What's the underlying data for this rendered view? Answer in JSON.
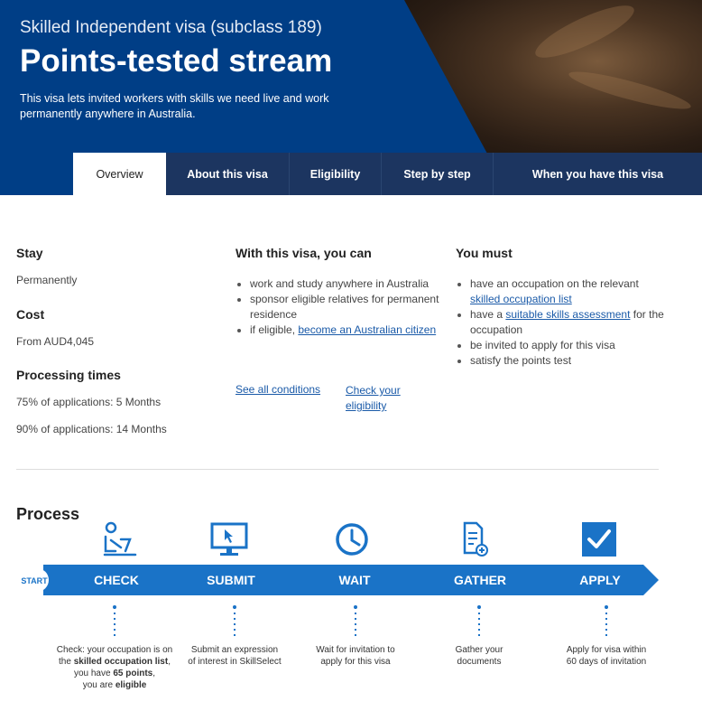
{
  "hero": {
    "subtitle": "Skilled Independent visa (subclass 189)",
    "title": "Points-tested stream",
    "description": "This visa lets invited workers with skills we need live and work permanently anywhere in Australia."
  },
  "tabs": [
    {
      "label": "Overview",
      "active": true
    },
    {
      "label": "About this visa",
      "active": false
    },
    {
      "label": "Eligibility",
      "active": false
    },
    {
      "label": "Step by step",
      "active": false
    },
    {
      "label": "When you have this visa",
      "active": false
    }
  ],
  "summary": {
    "stay_label": "Stay",
    "stay_value": "Permanently",
    "cost_label": "Cost",
    "cost_value": "From AUD4,045",
    "processing_label": "Processing times",
    "processing_75": "75% of applications: 5 Months",
    "processing_90": "90% of applications: 14 Months"
  },
  "can": {
    "heading": "With this visa, you can",
    "items": [
      "work and study anywhere in Australia",
      "sponsor eligible relatives for permanent residence"
    ],
    "item3_prefix": "if eligible, ",
    "item3_link": "become an Australian citizen"
  },
  "must": {
    "heading": "You must",
    "item1_prefix": "have an occupation on the relevant ",
    "item1_link": "skilled occupation list",
    "item2_prefix": "have a ",
    "item2_link": "suitable skills assessment",
    "item2_suffix": " for the occupation",
    "item3": "be invited to apply for this visa",
    "item4": "satisfy the points test"
  },
  "links": {
    "see_all": "See all conditions",
    "check_eligibility": "Check your eligibility"
  },
  "process": {
    "title": "Process",
    "start": "START",
    "accent": "#1a73c7",
    "steps": [
      {
        "label": "CHECK",
        "icon": "person-at-laptop-icon"
      },
      {
        "label": "SUBMIT",
        "icon": "monitor-cursor-icon"
      },
      {
        "label": "WAIT",
        "icon": "clock-icon"
      },
      {
        "label": "GATHER",
        "icon": "document-add-icon"
      },
      {
        "label": "APPLY",
        "icon": "checkbox-icon"
      }
    ],
    "desc_check_1": "Check: your occupation is on",
    "desc_check_2a": "the ",
    "desc_check_2b": "skilled occupation list",
    "desc_check_2c": ",",
    "desc_check_3a": "you have ",
    "desc_check_3b": "65 points",
    "desc_check_3c": ",",
    "desc_check_4a": "you are ",
    "desc_check_4b": "eligible",
    "desc_submit_1": "Submit an expression",
    "desc_submit_2": "of interest in SkillSelect",
    "desc_wait_1": "Wait for invitation to",
    "desc_wait_2": "apply for this visa",
    "desc_gather_1": "Gather your",
    "desc_gather_2": "documents",
    "desc_apply_1": "Apply for visa within",
    "desc_apply_2": "60 days of invitation"
  }
}
